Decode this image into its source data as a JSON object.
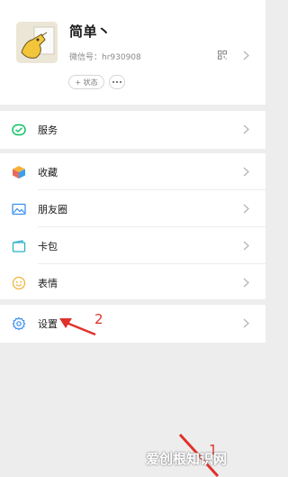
{
  "profile": {
    "name": "简单丶",
    "wechat_id": "微信号：hr930908",
    "status_button": "+ 状态"
  },
  "menu": {
    "service": "服务",
    "favorites": "收藏",
    "moments": "朋友圈",
    "cards": "卡包",
    "stickers": "表情",
    "settings": "设置"
  },
  "annotations": {
    "step1": "1",
    "step2": "2"
  },
  "watermark": "爱创根知识网",
  "colors": {
    "accent_red": "#e0312b",
    "wechat_green": "#07c160",
    "background": "#ededed"
  }
}
